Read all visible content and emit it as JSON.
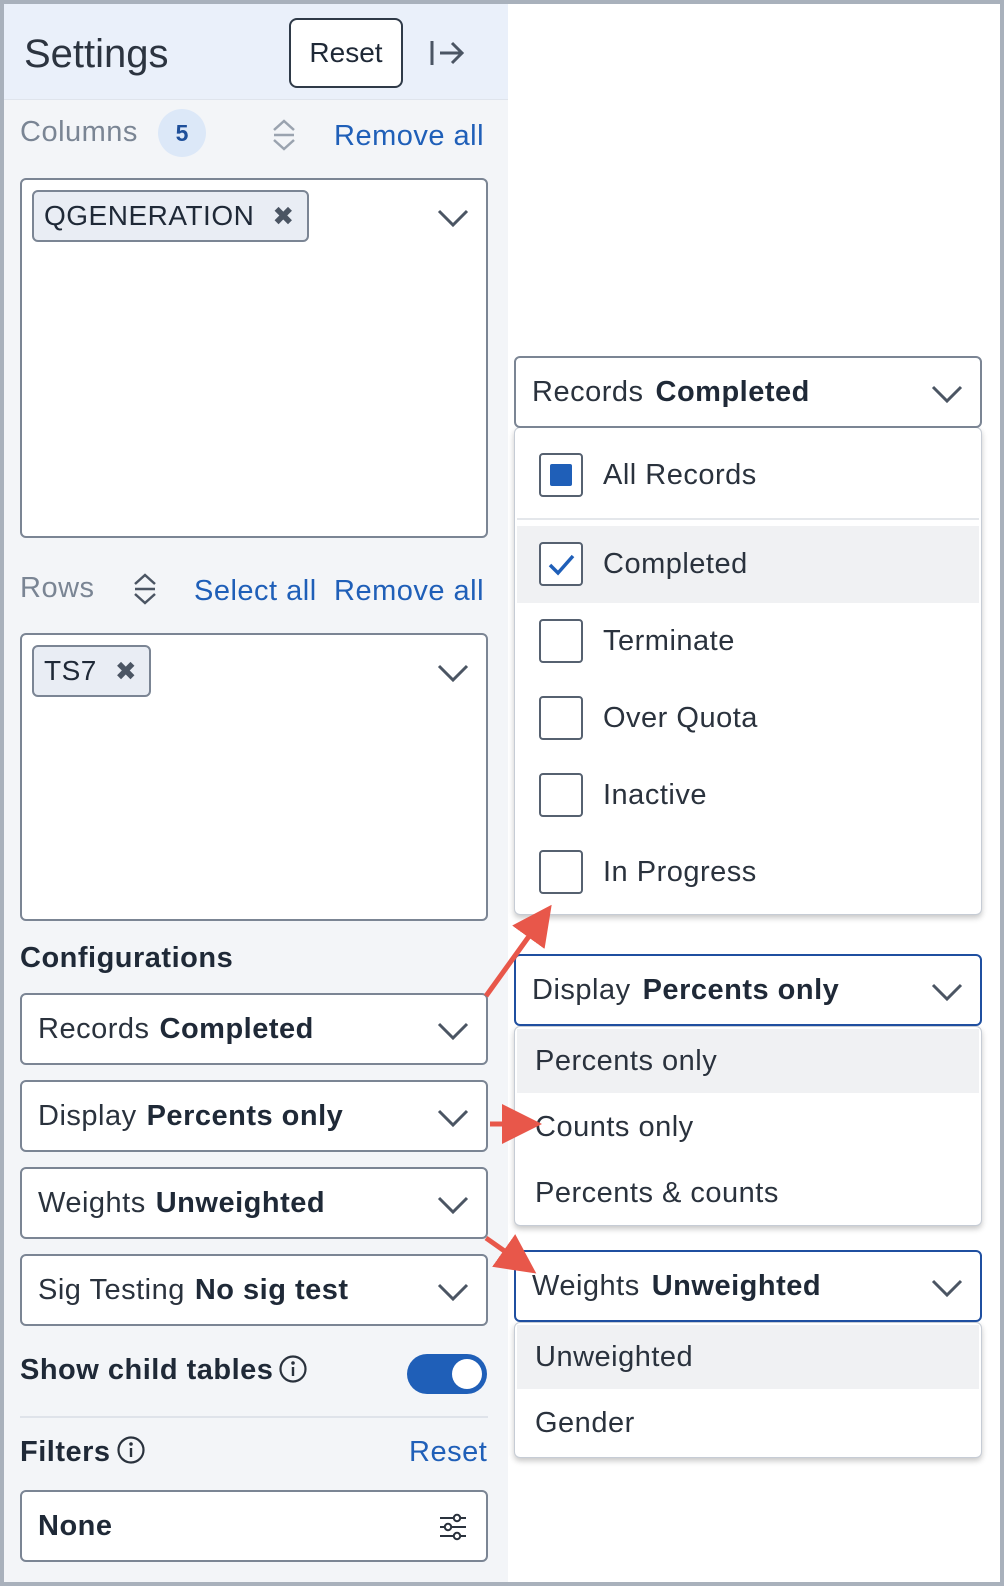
{
  "panel": {
    "title": "Settings",
    "reset_label": "Reset"
  },
  "columns": {
    "label": "Columns",
    "count": "5",
    "remove_all": "Remove all",
    "chips": [
      "QGENERATION"
    ]
  },
  "rows": {
    "label": "Rows",
    "select_all": "Select all",
    "remove_all": "Remove all",
    "chips": [
      "TS7"
    ]
  },
  "configurations": {
    "title": "Configurations",
    "selects": [
      {
        "label": "Records",
        "value": "Completed"
      },
      {
        "label": "Display",
        "value": "Percents only"
      },
      {
        "label": "Weights",
        "value": "Unweighted"
      },
      {
        "label": "Sig Testing",
        "value": "No sig test"
      }
    ]
  },
  "child_tables": {
    "label": "Show child tables",
    "enabled": true
  },
  "filters": {
    "label": "Filters",
    "reset_label": "Reset",
    "value": "None"
  },
  "records_dropdown": {
    "label": "Records",
    "value": "Completed",
    "options": [
      {
        "label": "All Records",
        "state": "partial"
      },
      {
        "label": "Completed",
        "state": "checked"
      },
      {
        "label": "Terminate",
        "state": "unchecked"
      },
      {
        "label": "Over Quota",
        "state": "unchecked"
      },
      {
        "label": "Inactive",
        "state": "unchecked"
      },
      {
        "label": "In Progress",
        "state": "unchecked"
      }
    ]
  },
  "display_dropdown": {
    "label": "Display",
    "value": "Percents only",
    "options": [
      "Percents only",
      "Counts only",
      "Percents & counts"
    ]
  },
  "weights_dropdown": {
    "label": "Weights",
    "value": "Unweighted",
    "options": [
      "Unweighted",
      "Gender"
    ]
  },
  "colors": {
    "accent": "#1f5fb8",
    "arrow": "#e8574a",
    "border": "#7b8594",
    "panel_bg": "#f3f5f8"
  }
}
